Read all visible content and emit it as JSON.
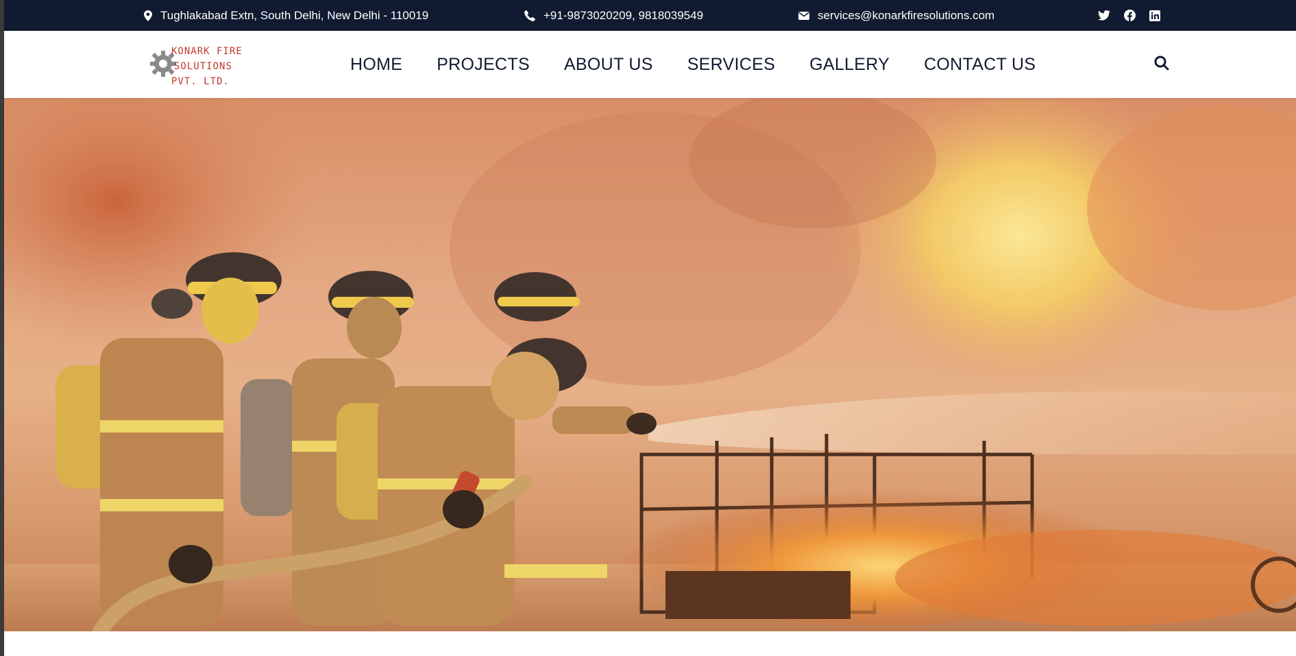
{
  "topbar": {
    "address": "Tughlakabad Extn, South Delhi, New Delhi - 110019",
    "phone": "+91-9873020209, 9818039549",
    "email": "services@konarkfiresolutions.com",
    "icons": [
      "map-pin-icon",
      "phone-icon",
      "envelope-icon"
    ],
    "socials": [
      "twitter-icon",
      "facebook-icon",
      "linkedin-icon"
    ],
    "background": "#101a30"
  },
  "logo": {
    "line1": "KONARK FIRE",
    "line2": "SOLUTIONS",
    "line3": "PVT. LTD.",
    "color": "#c0392b"
  },
  "nav": {
    "items": [
      {
        "label": "HOME"
      },
      {
        "label": "PROJECTS"
      },
      {
        "label": "ABOUT US"
      },
      {
        "label": "SERVICES"
      },
      {
        "label": "GALLERY"
      },
      {
        "label": "CONTACT US"
      }
    ],
    "search_icon": "search-icon"
  },
  "hero": {
    "image": "firefighters-spraying-water-on-fire"
  }
}
